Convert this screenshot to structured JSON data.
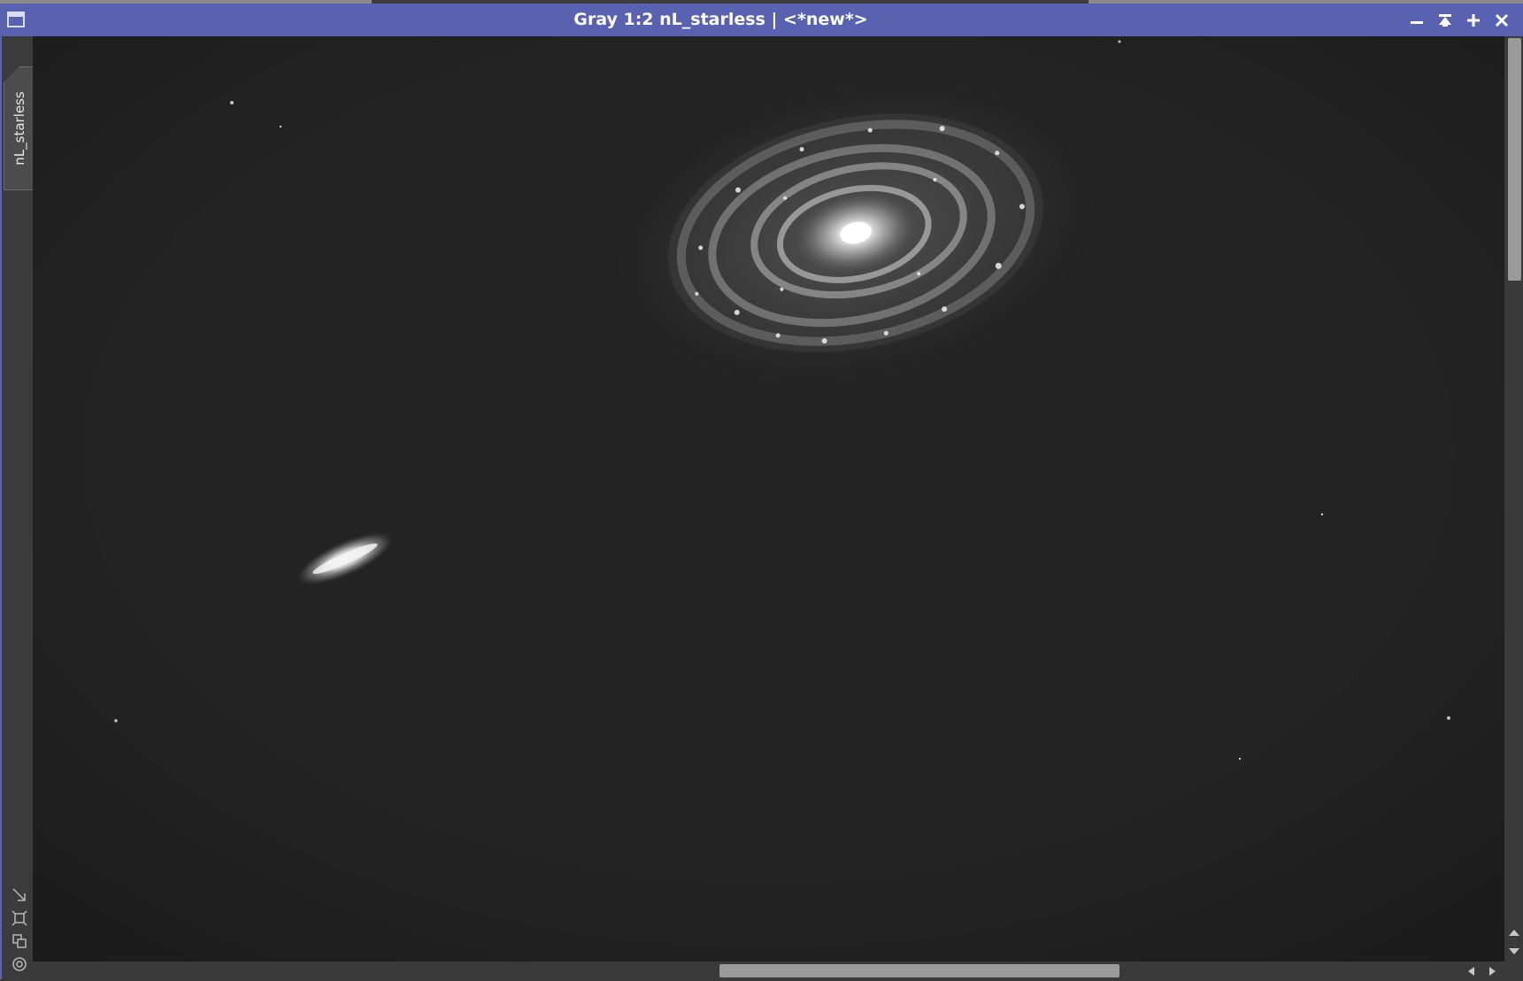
{
  "window": {
    "title": "Gray 1:2 nL_starless | <*new*>",
    "accent_color": "#5862b0",
    "buttons": [
      {
        "name": "minimize-icon"
      },
      {
        "name": "shade-icon"
      },
      {
        "name": "maximize-icon"
      },
      {
        "name": "close-icon"
      }
    ]
  },
  "view_tab": {
    "label": "nL_starless"
  },
  "left_tools": [
    {
      "name": "fit-view-icon"
    },
    {
      "name": "zoom-to-fit-icon"
    },
    {
      "name": "clone-view-icon"
    },
    {
      "name": "target-icon"
    }
  ],
  "image": {
    "content": "grayscale astronomical image with a spiral galaxy and an edge-on galaxy",
    "background_color": "#212121"
  }
}
